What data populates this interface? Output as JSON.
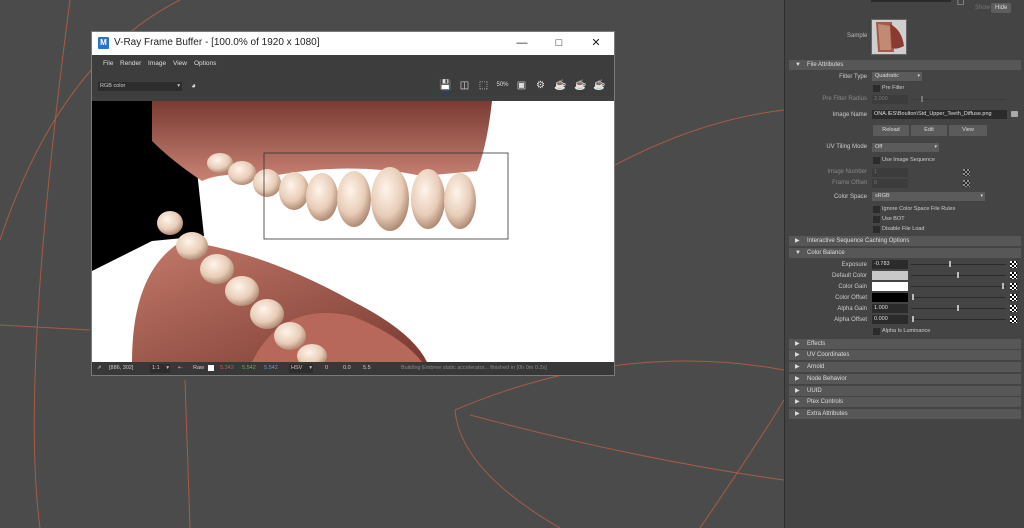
{
  "vfb": {
    "title": "V-Ray Frame Buffer - [100.0% of 1920 x 1080]",
    "logo": "M",
    "menu": [
      "File",
      "Render",
      "Image",
      "View",
      "Options"
    ],
    "channel": "RGB color",
    "toolbar_icons": [
      "save-icon",
      "clear-icon",
      "region-render-icon",
      "size-50-icon",
      "overlay-icon",
      "render-last-icon",
      "render-icon",
      "stop-render-icon",
      "teapot-icon"
    ],
    "status": {
      "coords": "[886, 302]",
      "zoom": "1:1",
      "raw_label": "Raw",
      "r": "5.342",
      "g": "5.542",
      "b": "5.542",
      "mode": "HSV",
      "v1": "0",
      "v2": "0.0",
      "v3": "5.5",
      "message": "Building Embree static accelerator... finished in [0h 0m 0.2s]"
    },
    "colors": {
      "r": "#d9534f",
      "g": "#5cb85c",
      "b": "#5b9bd5"
    }
  },
  "attribute_editor": {
    "show": "Show",
    "hide": "Hide",
    "sample_label": "Sample",
    "sections": {
      "file_attributes": "File Attributes",
      "interactive_caching": "Interactive Sequence Caching Options",
      "color_balance": "Color Balance",
      "effects": "Effects",
      "uv_coordinates": "UV Coordinates",
      "arnold": "Arnold",
      "node_behavior": "Node Behavior",
      "uuid": "UUID",
      "ptex_controls": "Ptex Controls",
      "extra_attributes": "Extra Attributes"
    },
    "file": {
      "filter_type_label": "Filter Type",
      "filter_type": "Quadratic",
      "pre_filter": "Pre Filter",
      "pre_filter_radius_label": "Pre Filter Radius",
      "pre_filter_radius": "2.000",
      "image_name_label": "Image Name",
      "image_name": "ONA.IES\\Boulton\\Std_Upper_Teeth_Diffuse.png",
      "reload": "Reload",
      "edit": "Edit",
      "view": "View",
      "uv_tiling_label": "UV Tiling Mode",
      "uv_tiling": "Off",
      "use_image_sequence": "Use Image Sequence",
      "image_number_label": "Image Number",
      "image_number": "1",
      "frame_offset_label": "Frame Offset",
      "frame_offset": "0",
      "color_space_label": "Color Space",
      "color_space": "sRGB",
      "ignore_color_space": "Ignore Color Space File Rules",
      "use_bot": "Use BOT",
      "disable_file_load": "Disable File Load"
    },
    "color_balance": {
      "exposure_label": "Exposure",
      "exposure": "-0.783",
      "default_color_label": "Default Color",
      "color_gain_label": "Color Gain",
      "color_offset_label": "Color Offset",
      "alpha_gain_label": "Alpha Gain",
      "alpha_gain": "1.000",
      "alpha_offset_label": "Alpha Offset",
      "alpha_offset": "0.000",
      "alpha_is_luminance": "Alpha Is Luminance",
      "default_color": "#c8c8c8",
      "color_gain": "#ffffff",
      "color_offset": "#000000"
    }
  }
}
